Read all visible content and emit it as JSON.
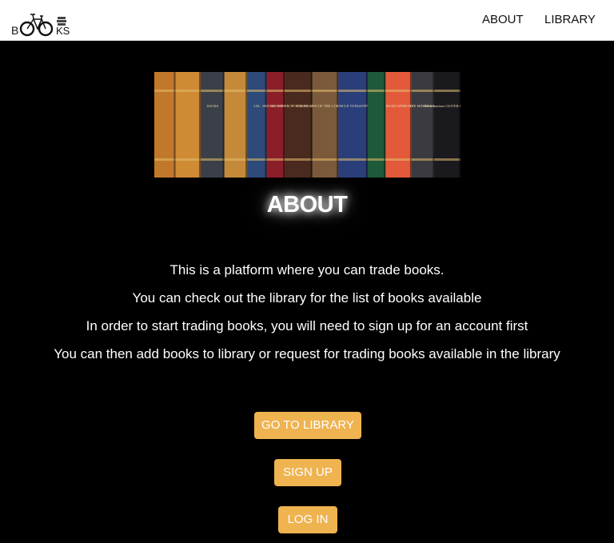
{
  "nav": {
    "logo_text_left": "B",
    "logo_text_right": "KS",
    "about": "ABOUT",
    "library": "LIBRARY"
  },
  "banner": {
    "spines": [
      {
        "color": "#c1782a",
        "text": ""
      },
      {
        "color": "#cf8a34",
        "text": ""
      },
      {
        "color": "#3b4048",
        "text": "SACKS"
      },
      {
        "color": "#c48a3a",
        "text": ""
      },
      {
        "color": "#2d4a78",
        "text": "LSL"
      },
      {
        "color": "#8a1f2a",
        "text": "SEEING VOICES"
      },
      {
        "color": "#4a2a1e",
        "text": "AN ANTHROPOLOGIST ON MARS"
      },
      {
        "color": "#7a5a3a",
        "text": "THE ISLAND OF THE COLORBLIND"
      },
      {
        "color": "#2a3f7a",
        "text": "UNCLE TUNGSTEN"
      },
      {
        "color": "#1e5a3a",
        "text": ""
      },
      {
        "color": "#e25a3a",
        "text": "MUSICOPHILIA"
      },
      {
        "color": "#3a3a40",
        "text": "THE MIND'S EYE"
      },
      {
        "color": "#1a1a1e",
        "text": "Hallucinations OLIVER SACKS"
      }
    ]
  },
  "main": {
    "heading": "ABOUT",
    "paragraphs": [
      "This is a platform where you can trade books.",
      "You can check out the library for the list of books available",
      "In order to start trading books, you will need to sign up for an account first",
      "You can then add books to library or request for trading books available in the library"
    ],
    "buttons": {
      "library": "GO TO LIBRARY",
      "signup": "SIGN UP",
      "login": "LOG IN"
    }
  },
  "colors": {
    "accent": "#efb350",
    "background": "#000000",
    "navbar": "#ffffff"
  }
}
